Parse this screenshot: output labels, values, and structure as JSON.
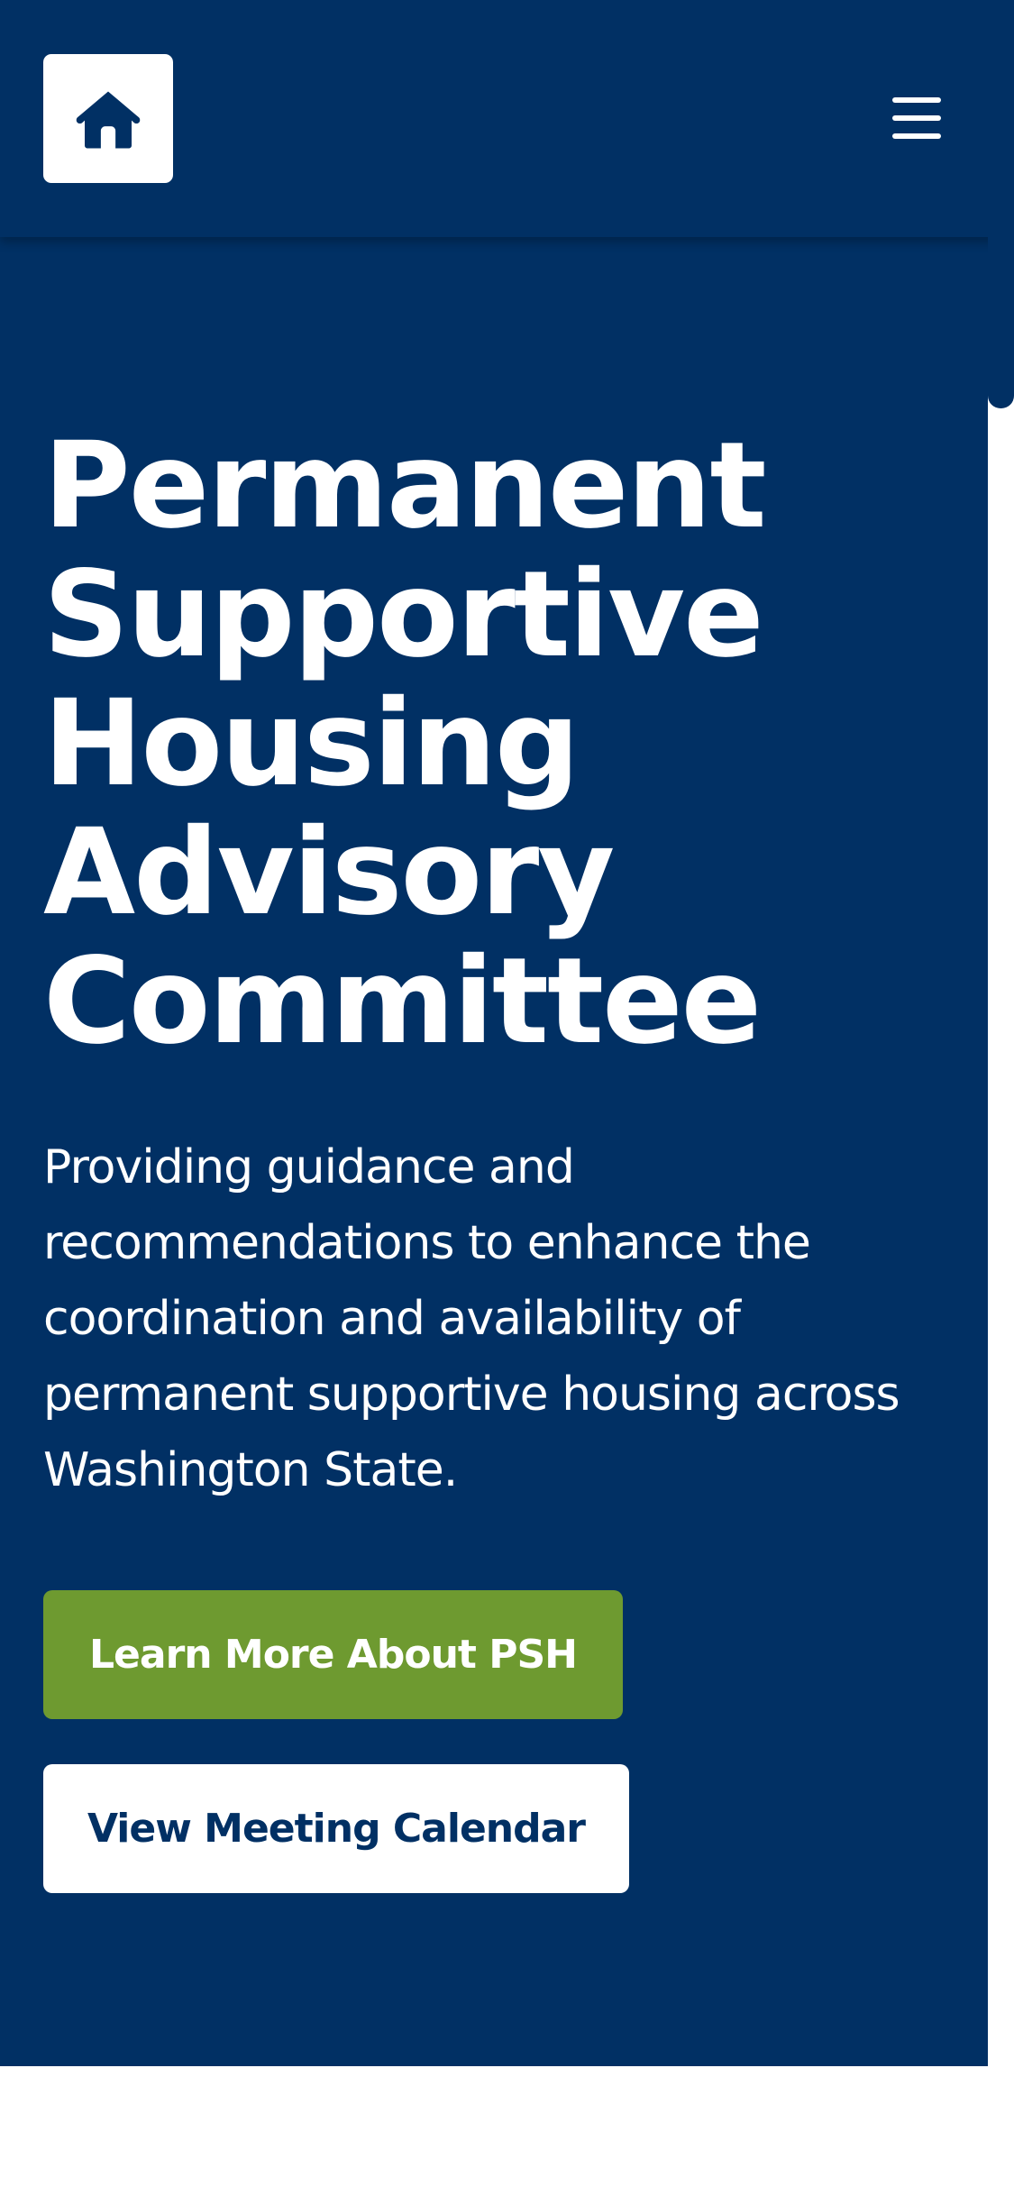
{
  "header": {
    "logo_icon": "home-icon",
    "menu_icon": "hamburger-menu-icon"
  },
  "hero": {
    "title": "Permanent Supportive Housing Advisory Committee",
    "description": "Providing guidance and recommendations to enhance the coordination and availability of permanent supportive housing across Washington State.",
    "primary_button_label": "Learn More About PSH",
    "secondary_button_label": "View Meeting Calendar"
  },
  "colors": {
    "brand_navy": "#013064",
    "accent_green": "#6e9a30",
    "white": "#ffffff"
  }
}
